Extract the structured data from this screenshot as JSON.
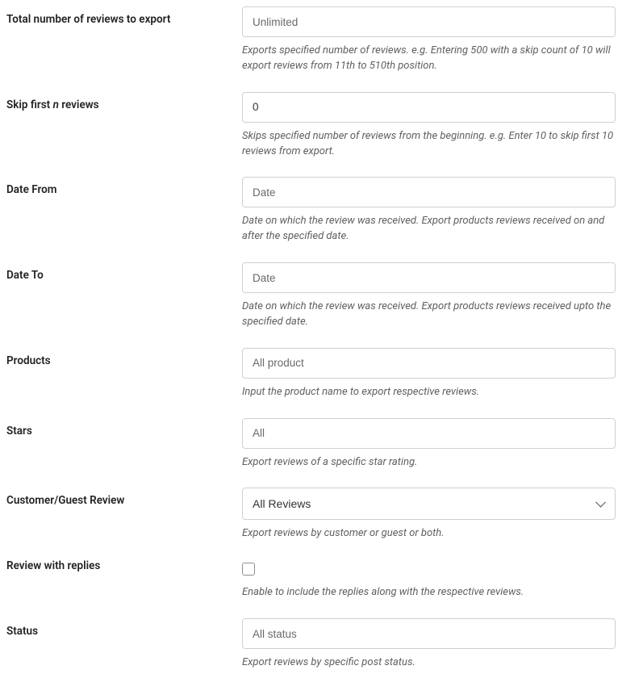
{
  "fields": {
    "total_reviews": {
      "label": "Total number of reviews to export",
      "placeholder": "Unlimited",
      "help": "Exports specified number of reviews. e.g. Entering 500 with a skip count of 10 will export reviews from 11th to 510th position."
    },
    "skip": {
      "label_pre": "Skip first ",
      "label_em": "n",
      "label_post": " reviews",
      "value": "0",
      "help": "Skips specified number of reviews from the beginning. e.g. Enter 10 to skip first 10 reviews from export."
    },
    "date_from": {
      "label": "Date From",
      "placeholder": "Date",
      "help": "Date on which the review was received. Export products reviews received on and after the specified date."
    },
    "date_to": {
      "label": "Date To",
      "placeholder": "Date",
      "help": "Date on which the review was received. Export products reviews received upto the specified date."
    },
    "products": {
      "label": "Products",
      "placeholder": "All product",
      "help": "Input the product name to export respective reviews."
    },
    "stars": {
      "label": "Stars",
      "placeholder": "All",
      "help": "Export reviews of a specific star rating."
    },
    "customer_guest": {
      "label": "Customer/Guest Review",
      "selected": "All Reviews",
      "help": "Export reviews by customer or guest or both."
    },
    "replies": {
      "label": "Review with replies",
      "help": "Enable to include the replies along with the respective reviews."
    },
    "status": {
      "label": "Status",
      "placeholder": "All status",
      "help": "Export reviews by specific post status."
    }
  }
}
